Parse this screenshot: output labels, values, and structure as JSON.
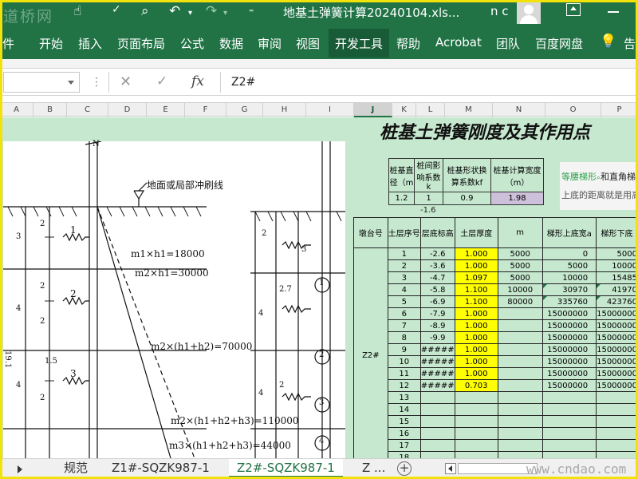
{
  "titlebar": {
    "title": "地基土弹簧计算20240104.xls...",
    "user": "n c",
    "watermark": "道桥网"
  },
  "ribbon": {
    "tabs": [
      "件",
      "开始",
      "插入",
      "页面布局",
      "公式",
      "数据",
      "审阅",
      "视图",
      "开发工具",
      "帮助",
      "Acrobat",
      "团队",
      "百度网盘",
      "告"
    ],
    "active": "开发工具"
  },
  "formula_bar": {
    "name_box": "",
    "formula": "Z2#"
  },
  "columns": [
    "A",
    "B",
    "C",
    "D",
    "E",
    "F",
    "G",
    "H",
    "I",
    "J",
    "K",
    "L",
    "M",
    "N",
    "O",
    "P"
  ],
  "selected_column": "J",
  "drawing": {
    "ground_label": "地面或局部冲刷线",
    "n_mark": "N",
    "layer_numbers": [
      "1",
      "2",
      "3"
    ],
    "right_layer_numbers": [
      "1",
      "2",
      "3",
      "4"
    ],
    "depth_labels_left": [
      "3",
      "4",
      "4",
      "1.5",
      "2"
    ],
    "depth_labels_mid": [
      "2",
      "2",
      "2"
    ],
    "depth_labels_right": [
      "2",
      "2.7",
      "3",
      "4",
      "4",
      "2"
    ],
    "m_labels": [
      "m1×h1=18000",
      "m2×h1=30000",
      "m2×(h1+h2)=70000",
      "m2×(h1+h2+h3)=110000",
      "m3×(h1+h2+h3)=44000"
    ],
    "side_label": "19.1"
  },
  "sheet": {
    "heading": "桩基土弹簧刚度及其作用点",
    "param_headers": [
      "桩基直径（m",
      "桩间影响系数k",
      "桩基形状换算系数kf",
      "桩基计算宽度（m）"
    ],
    "param_values": [
      "1.2",
      "1",
      "0.9",
      "1.98"
    ],
    "note_line1": "等腰梯形",
    "note_line1b": "和直角梯",
    "note_line2": "上底的距离就是用高",
    "minus_value": "-1.6",
    "main_headers": [
      "墩台号",
      "土层序号",
      "层底标高",
      "土层厚度",
      "m",
      "梯形上底宽a",
      "梯形下底"
    ],
    "pier_label": "Z2#",
    "rows": [
      {
        "no": "1",
        "elev": "-2.6",
        "thick": "1.000",
        "m": "5000",
        "a": "0",
        "b": "5000"
      },
      {
        "no": "2",
        "elev": "-3.6",
        "thick": "1.000",
        "m": "5000",
        "a": "5000",
        "b": "10000"
      },
      {
        "no": "3",
        "elev": "-4.7",
        "thick": "1.097",
        "m": "5000",
        "a": "10000",
        "b": "15485"
      },
      {
        "no": "4",
        "elev": "-5.8",
        "thick": "1.100",
        "m": "10000",
        "a": "30970",
        "b": "41970"
      },
      {
        "no": "5",
        "elev": "-6.9",
        "thick": "1.100",
        "m": "80000",
        "a": "335760",
        "b": "423760"
      },
      {
        "no": "6",
        "elev": "-7.9",
        "thick": "1.000",
        "m": "",
        "a": "15000000",
        "b": "15000000"
      },
      {
        "no": "7",
        "elev": "-8.9",
        "thick": "1.000",
        "m": "",
        "a": "15000000",
        "b": "15000000"
      },
      {
        "no": "8",
        "elev": "-9.9",
        "thick": "1.000",
        "m": "",
        "a": "15000000",
        "b": "15000000"
      },
      {
        "no": "9",
        "elev": "#####",
        "thick": "1.000",
        "m": "",
        "a": "15000000",
        "b": "15000000"
      },
      {
        "no": "10",
        "elev": "#####",
        "thick": "1.000",
        "m": "",
        "a": "15000000",
        "b": "15000000"
      },
      {
        "no": "11",
        "elev": "#####",
        "thick": "1.000",
        "m": "",
        "a": "15000000",
        "b": "15000000"
      },
      {
        "no": "12",
        "elev": "#####",
        "thick": "0.703",
        "m": "",
        "a": "15000000",
        "b": "15000000"
      },
      {
        "no": "13",
        "elev": "",
        "thick": "",
        "m": "",
        "a": "",
        "b": ""
      },
      {
        "no": "14",
        "elev": "",
        "thick": "",
        "m": "",
        "a": "",
        "b": ""
      },
      {
        "no": "15",
        "elev": "",
        "thick": "",
        "m": "",
        "a": "",
        "b": ""
      },
      {
        "no": "16",
        "elev": "",
        "thick": "",
        "m": "",
        "a": "",
        "b": ""
      },
      {
        "no": "17",
        "elev": "",
        "thick": "",
        "m": "",
        "a": "",
        "b": ""
      },
      {
        "no": "18",
        "elev": "",
        "thick": "",
        "m": "",
        "a": "",
        "b": ""
      }
    ]
  },
  "sheet_tabs": [
    "规范",
    "Z1#-SQZK987-1",
    "Z2#-SQZK987-1",
    "Z ..."
  ],
  "active_sheet": "Z2#-SQZK987-1",
  "footer_watermark": "www.cndao.com",
  "colors": {
    "excel_green": "#217346",
    "grid_green": "#c6e8cf",
    "highlight_yellow": "#ffff00",
    "lavender": "#ccc0da"
  }
}
